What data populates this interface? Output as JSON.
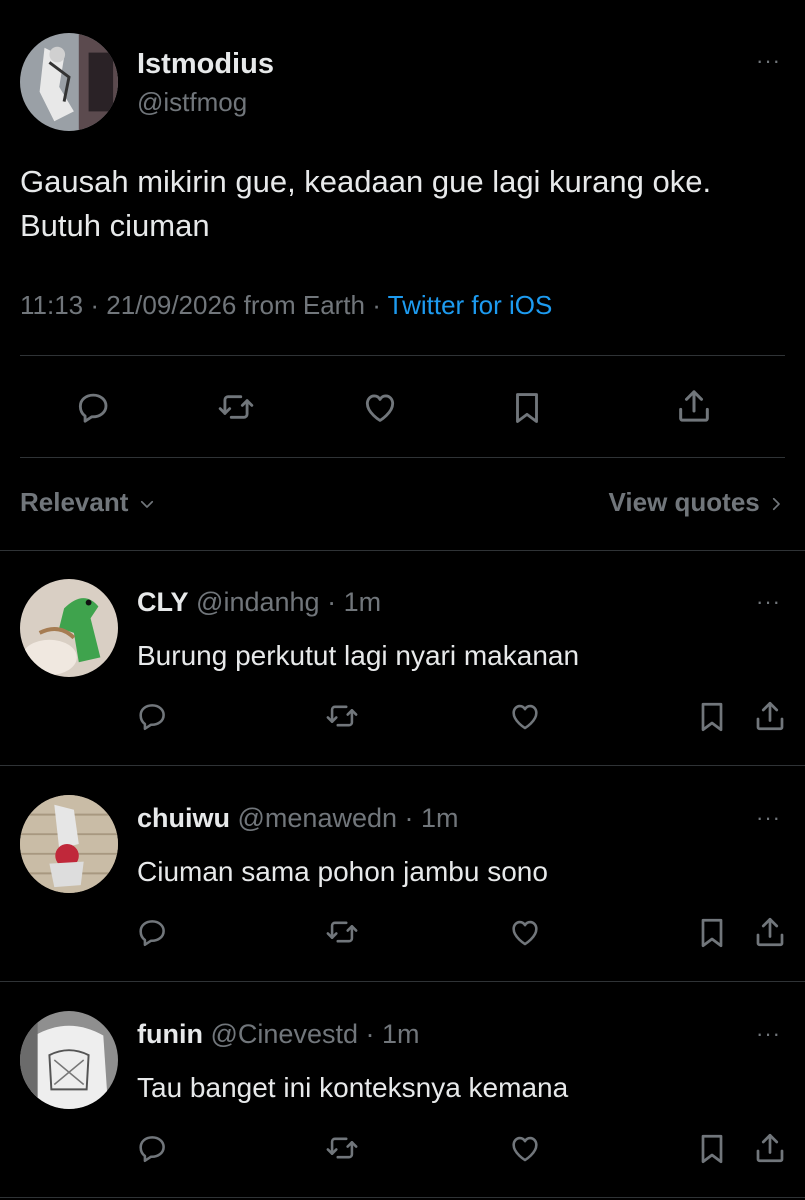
{
  "tweet": {
    "display_name": "Istmodius",
    "handle": "@istfmog",
    "text_line1": "Gausah mikirin gue, keadaan gue lagi kurang oke.",
    "text_line2": "Butuh ciuman",
    "time": "11:13",
    "date": "21/09/2026",
    "location": "from Earth",
    "app": "Twitter for iOS",
    "more": "···"
  },
  "sort": {
    "label": "Relevant",
    "view_quotes": "View quotes"
  },
  "replies": [
    {
      "name": "CLY",
      "handle": "@indanhg",
      "time": "1m",
      "text": "Burung perkutut lagi nyari makanan"
    },
    {
      "name": "chuiwu",
      "handle": "@menawedn",
      "time": "1m",
      "text": "Ciuman sama pohon jambu sono"
    },
    {
      "name": "funin",
      "handle": "@Cinevestd",
      "time": "1m",
      "text": "Tau banget ini konteksnya kemana"
    }
  ],
  "separator": " · ",
  "colors": {
    "background": "#000000",
    "text": "#e7e9ea",
    "muted": "#71767b",
    "accent": "#1d9bf0",
    "divider": "#2f3336"
  },
  "icons": [
    "reply-icon",
    "retweet-icon",
    "like-icon",
    "bookmark-icon",
    "share-icon",
    "chevron-down-icon",
    "chevron-right-icon",
    "more-icon"
  ]
}
